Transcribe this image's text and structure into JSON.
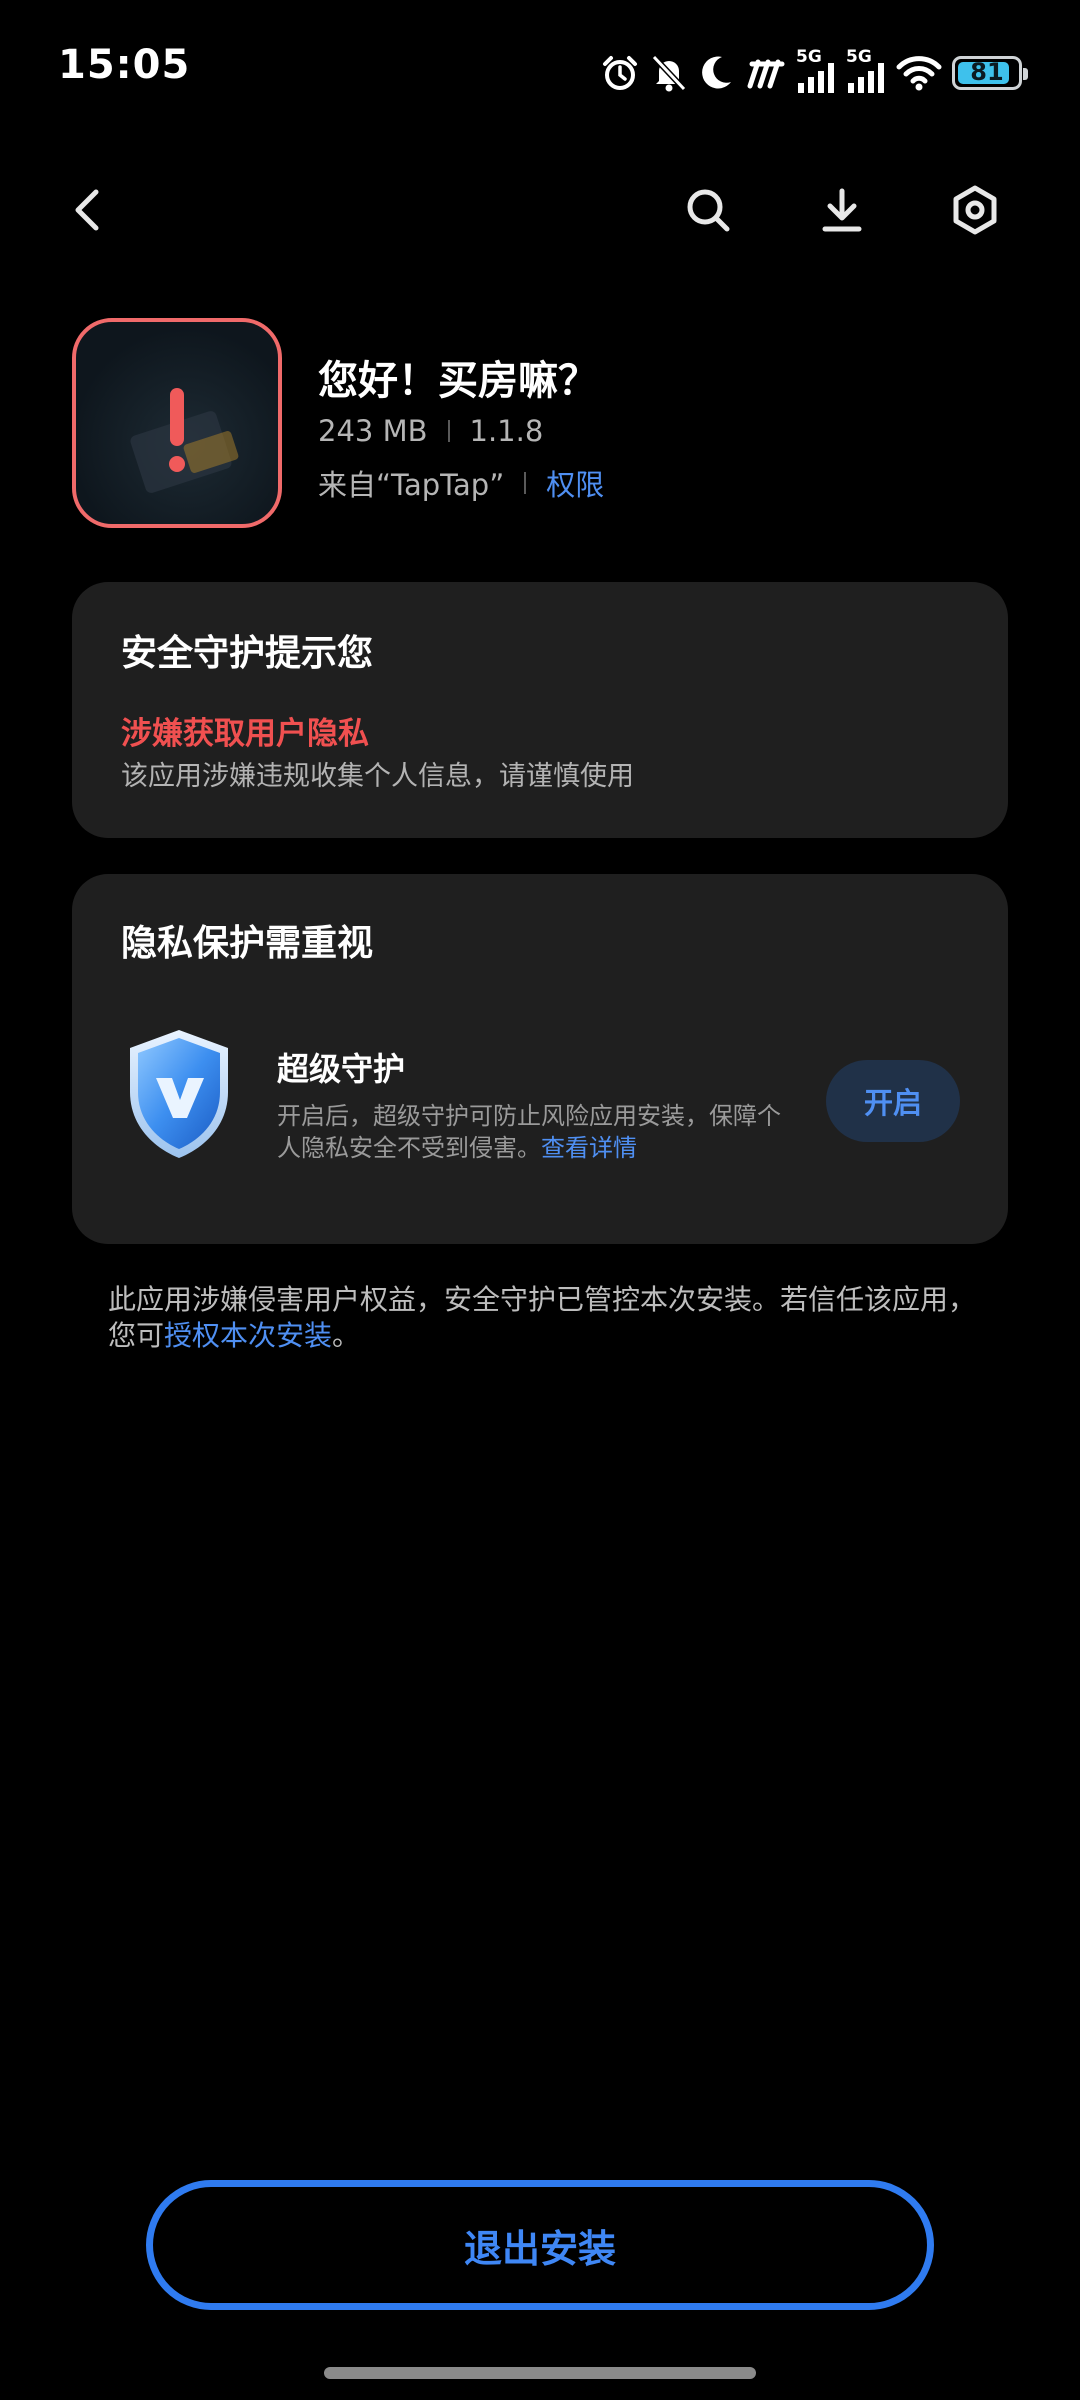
{
  "status_bar": {
    "time": "15:05",
    "battery_level": "81",
    "network_label": "5G",
    "icons": [
      "alarm-icon",
      "mute-icon",
      "moon-icon",
      "hd-icon",
      "signal-5g-icon",
      "signal-5g-icon",
      "wifi-icon",
      "battery-icon"
    ]
  },
  "toolbar": {
    "icons": [
      "back-icon",
      "search-icon",
      "download-icon",
      "settings-icon"
    ]
  },
  "app": {
    "name": "您好！买房嘛？",
    "size": "243 MB",
    "version": "1.1.8",
    "source": "来自“TapTap”",
    "permissions_link": "权限"
  },
  "security_card": {
    "title": "安全守护提示您",
    "warning_title": "涉嫌获取用户隐私",
    "warning_desc": "该应用涉嫌违规收集个人信息，请谨慎使用"
  },
  "privacy_card": {
    "title": "隐私保护需重视",
    "feature_title": "超级守护",
    "feature_desc": "开启后，超级守护可防止风险应用安装，保障个人隐私安全不受到侵害。",
    "feature_link": "查看详情",
    "enable_button": "开启"
  },
  "notice": {
    "text": "此应用涉嫌侵害用户权益，安全守护已管控本次安装。若信任该应用，您可",
    "link": "授权本次安装",
    "suffix": "。"
  },
  "footer": {
    "exit_button": "退出安装"
  },
  "colors": {
    "accent": "#4f8ff2",
    "danger": "#f05050",
    "card_bg": "#1f1f1f",
    "background": "#000000"
  }
}
